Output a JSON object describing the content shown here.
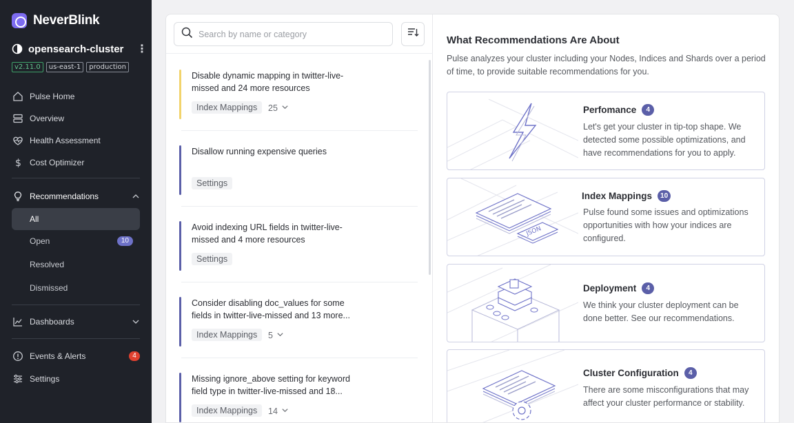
{
  "brand": {
    "name": "NeverBlink"
  },
  "cluster": {
    "name": "opensearch-cluster",
    "tags": [
      "v2.11.0",
      "us-east-1",
      "production"
    ]
  },
  "nav": {
    "pulse_home": "Pulse Home",
    "overview": "Overview",
    "health": "Health Assessment",
    "cost": "Cost Optimizer",
    "recommendations": "Recommendations",
    "sub": {
      "all": "All",
      "open": "Open",
      "open_count": "10",
      "resolved": "Resolved",
      "dismissed": "Dismissed"
    },
    "dashboards": "Dashboards",
    "events": "Events & Alerts",
    "events_count": "4",
    "settings": "Settings"
  },
  "search": {
    "placeholder": "Search by name or category"
  },
  "recommendations": [
    {
      "title": "Disable dynamic mapping in twitter-live-missed and 24 more resources",
      "category": "Index Mappings",
      "count": "25",
      "accent": "#f2d36b"
    },
    {
      "title": "Disallow running expensive queries",
      "category": "Settings",
      "count": "",
      "accent": "#5b5fa8"
    },
    {
      "title": "Avoid indexing URL fields in twitter-live-missed and 4 more resources",
      "category": "Settings",
      "count": "",
      "accent": "#5b5fa8"
    },
    {
      "title": "Consider disabling doc_values for some fields in twitter-live-missed and 13 more...",
      "category": "Index Mappings",
      "count": "5",
      "accent": "#5b5fa8"
    },
    {
      "title": "Missing ignore_above setting for keyword field type in twitter-live-missed and 18...",
      "category": "Index Mappings",
      "count": "14",
      "accent": "#5b5fa8"
    }
  ],
  "about": {
    "title": "What Recommendations Are About",
    "description": "Pulse analyzes your cluster including your Nodes, Indices and Shards over a period of time, to provide suitable recommendations for you.",
    "cards": [
      {
        "title": "Perfomance",
        "count": "4",
        "description": "Let's get your cluster in tip-top shape. We detected some possible optimizations, and have recommendations for you to apply."
      },
      {
        "title": "Index Mappings",
        "count": "10",
        "description": "Pulse found some issues and optimizations opportunities with how your indices are configured."
      },
      {
        "title": "Deployment",
        "count": "4",
        "description": "We think your cluster deployment can be done better. See our recommendations."
      },
      {
        "title": "Cluster Configuration",
        "count": "4",
        "description": "There are some misconfigurations that may affect your cluster performance or stability."
      }
    ],
    "illustration_json_label": "JSON"
  },
  "colors": {
    "accent": "#5b5fa8",
    "sidebar": "#1f2229",
    "warning": "#f2d36b",
    "alert": "#e0412f"
  }
}
